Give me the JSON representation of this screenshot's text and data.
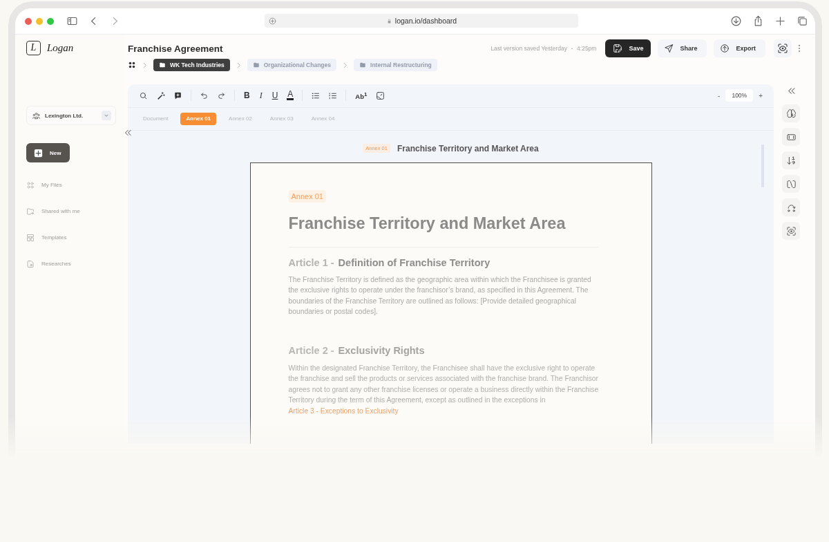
{
  "browser": {
    "url": "logan.io/dashboard"
  },
  "sidebar": {
    "logo_mark": "L",
    "logo_text": "Logan",
    "organization": "Lexington Ltd.",
    "new_button": "New",
    "items": [
      {
        "label": "My Files",
        "kind": "files"
      },
      {
        "label": "Shared with me",
        "kind": "shared"
      },
      {
        "label": "Templates",
        "kind": "templates"
      },
      {
        "label": "Researches",
        "kind": "researches"
      }
    ]
  },
  "header": {
    "title": "Franchise Agreement",
    "last_saved": "Last version saved Yesterday",
    "separator": "•",
    "time": "4:25pm",
    "breadcrumbs": [
      {
        "label": "WK Tech Industries",
        "selected": true
      },
      {
        "label": "Organizational Changes",
        "selected": false
      },
      {
        "label": "Internal Restructuring",
        "selected": false
      }
    ],
    "buttons": [
      {
        "label": "Save",
        "kind": "save"
      },
      {
        "label": "Share",
        "kind": "share"
      },
      {
        "label": "Export",
        "kind": "export"
      }
    ]
  },
  "editor": {
    "toolbar": [
      {
        "kind": "search"
      },
      {
        "kind": "magic"
      },
      {
        "kind": "comment"
      },
      {
        "kind": "divider"
      },
      {
        "kind": "undo"
      },
      {
        "kind": "redo"
      },
      {
        "kind": "divider"
      },
      {
        "kind": "bold",
        "glyph": "B"
      },
      {
        "kind": "italic",
        "glyph": "I"
      },
      {
        "kind": "underline",
        "glyph": "U"
      },
      {
        "kind": "text-color",
        "glyph": "A"
      },
      {
        "kind": "divider"
      },
      {
        "kind": "bullets"
      },
      {
        "kind": "numbers"
      },
      {
        "kind": "divider"
      },
      {
        "kind": "superscript",
        "glyph": "Ab$^{1}$"
      },
      {
        "kind": "image"
      }
    ],
    "zoom_out": "-",
    "zoom": "100%",
    "zoom_in": "+",
    "tabs": [
      {
        "label": "Document",
        "selected": false
      },
      {
        "label": "Annex 01",
        "selected": true
      },
      {
        "label": "Annex 02",
        "selected": false
      },
      {
        "label": "Annex 03",
        "selected": false
      },
      {
        "label": "Annex 04",
        "selected": false
      }
    ],
    "section_tag": "Annex 01",
    "section_title": "Franchise Territory and Market Area",
    "page": {
      "tag": "Annex 01",
      "title": "Franchise Territory and Market Area",
      "articles": [
        {
          "number": "Article 1",
          "separator": "-",
          "title": "Definition of Franchise Territory",
          "body": "The Franchise Territory is defined as the geographic area within which the Franchisee is granted the exclusive rights to operate under the franchisor’s brand, as specified in this Agreement. The boundaries of the Franchise Territory are outlined as follows: [Provide detailed geographical boundaries or postal codes]."
        },
        {
          "number": "Article 2",
          "separator": "-",
          "title": "Exclusivity Rights",
          "body": "Within the designated Franchise Territory, the Franchisee shall have the exclusive right to operate the franchise and sell the products or services associated with the franchise brand. The Franchisor agrees not to grant any other franchise licenses or operate a business directly within the Franchise Territory during the term of this Agreement, except as outlined in the exceptions in ",
          "link": "Article 3 - Exceptions to Exclusivity"
        }
      ]
    }
  },
  "right_rail": [
    {
      "kind": "brain"
    },
    {
      "kind": "frame"
    },
    {
      "kind": "sort"
    },
    {
      "kind": "rotate"
    },
    {
      "kind": "redo-nodes"
    },
    {
      "kind": "eye"
    }
  ]
}
